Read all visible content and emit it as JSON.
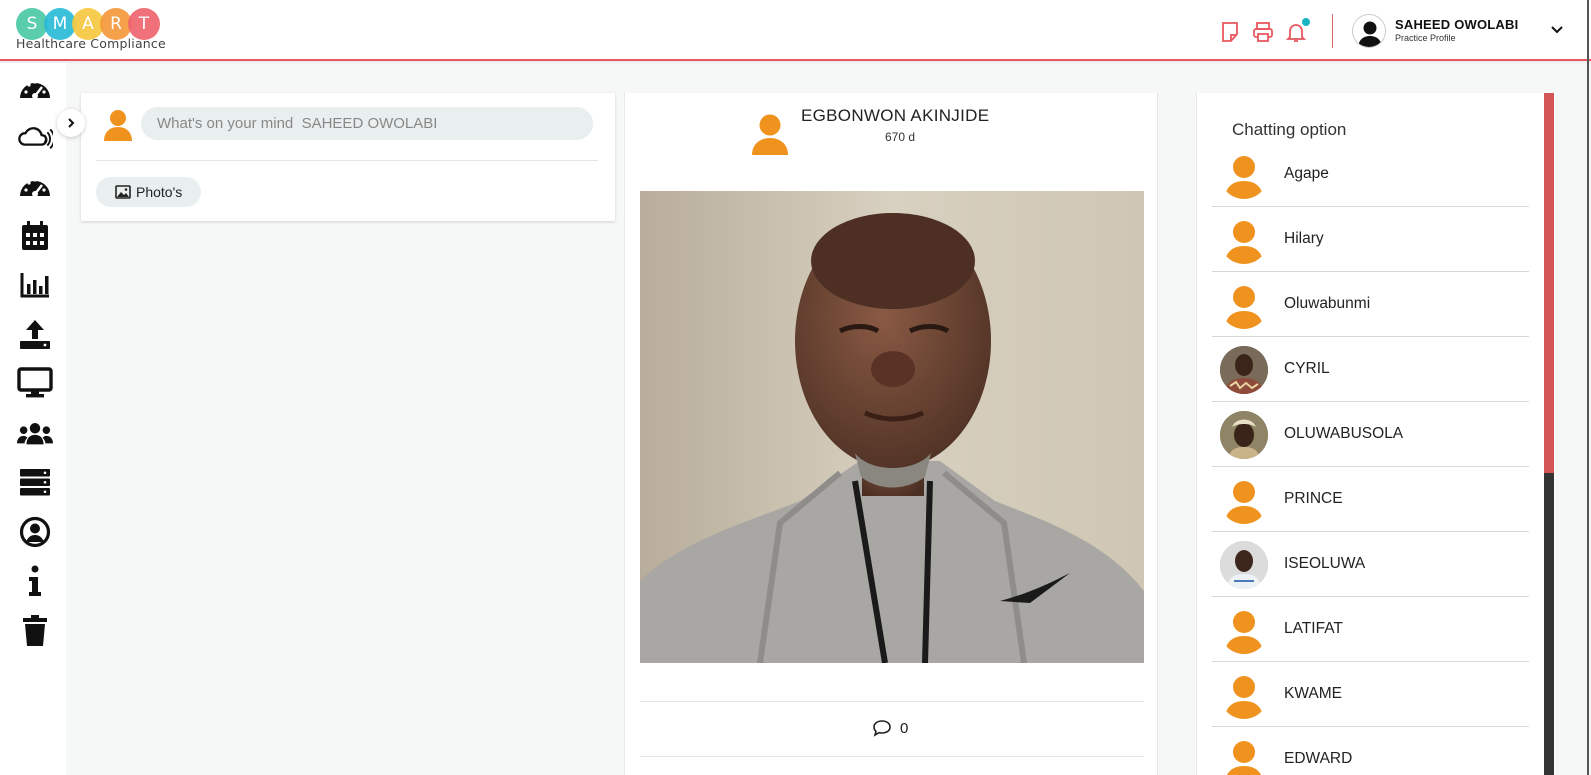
{
  "colors": {
    "accent": "#e8575f",
    "avatar_orange": "#f0921e",
    "notification_dot": "#18b5c3",
    "logo": [
      "#4cc9a6",
      "#2bbbd6",
      "#f5c842",
      "#f59a3d",
      "#f0666f"
    ]
  },
  "header": {
    "logo_letters": [
      "S",
      "M",
      "A",
      "R",
      "T"
    ],
    "logo_subtitle": "Healthcare Compliance",
    "icons": [
      "note-icon",
      "printer-icon",
      "bell-icon"
    ],
    "user": {
      "name": "SAHEED OWOLABI",
      "subtitle": "Practice Profile"
    }
  },
  "sidebar": {
    "items": [
      {
        "icon": "dashboard-gauge-icon"
      },
      {
        "icon": "cloud-signal-icon"
      },
      {
        "icon": "gauge-icon"
      },
      {
        "icon": "calendar-icon"
      },
      {
        "icon": "bar-chart-icon"
      },
      {
        "icon": "upload-icon"
      },
      {
        "icon": "monitor-icon"
      },
      {
        "icon": "users-group-icon"
      },
      {
        "icon": "server-icon"
      },
      {
        "icon": "user-circle-icon"
      },
      {
        "icon": "info-icon"
      },
      {
        "icon": "trash-icon"
      }
    ]
  },
  "composer": {
    "placeholder": "What's on your mind  SAHEED OWOLABI",
    "photos_label": "Photo's"
  },
  "post": {
    "author": "EGBONWON AKINJIDE",
    "time": "670 d",
    "comment_count": "0"
  },
  "chat": {
    "title": "Chatting option",
    "contacts": [
      {
        "name": "Agape",
        "avatar": "default"
      },
      {
        "name": "Hilary",
        "avatar": "default"
      },
      {
        "name": "Oluwabunmi",
        "avatar": "default"
      },
      {
        "name": "CYRIL",
        "avatar": "photo"
      },
      {
        "name": "OLUWABUSOLA",
        "avatar": "photo"
      },
      {
        "name": "PRINCE",
        "avatar": "default"
      },
      {
        "name": "ISEOLUWA",
        "avatar": "photo"
      },
      {
        "name": "LATIFAT",
        "avatar": "default"
      },
      {
        "name": "KWAME",
        "avatar": "default"
      },
      {
        "name": "EDWARD",
        "avatar": "default"
      }
    ]
  }
}
